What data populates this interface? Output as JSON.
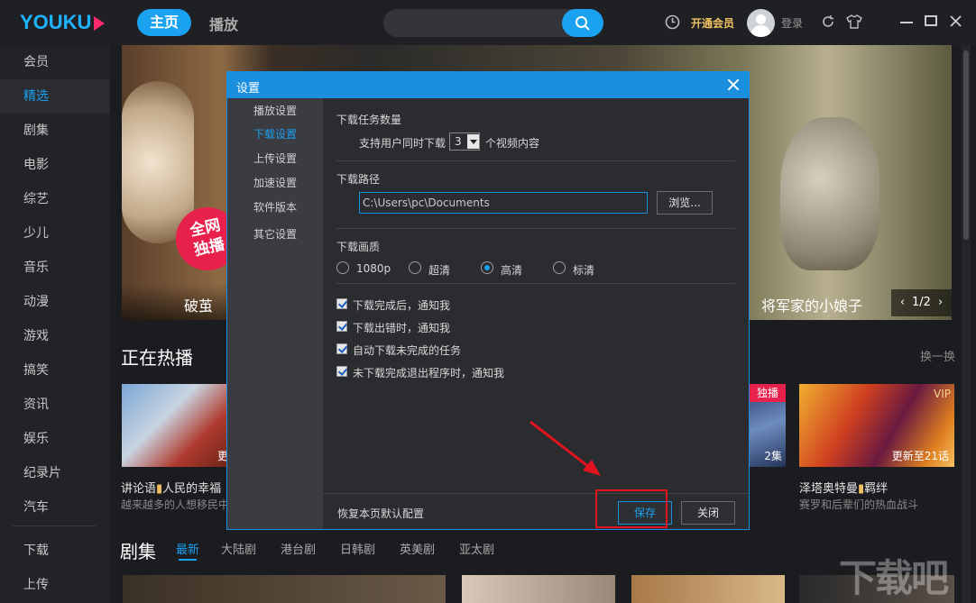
{
  "app": {
    "logo_main": "YOUKU",
    "nav_home": "主页",
    "nav_play": "播放",
    "search_placeholder": "",
    "vip_open": "开通会员",
    "login": "登录"
  },
  "sidebar": {
    "items": [
      {
        "label": "会员"
      },
      {
        "label": "精选"
      },
      {
        "label": "剧集"
      },
      {
        "label": "电影"
      },
      {
        "label": "综艺"
      },
      {
        "label": "少儿"
      },
      {
        "label": "音乐"
      },
      {
        "label": "动漫"
      },
      {
        "label": "游戏"
      },
      {
        "label": "搞笑"
      },
      {
        "label": "资讯"
      },
      {
        "label": "娱乐"
      },
      {
        "label": "纪录片"
      },
      {
        "label": "汽车"
      },
      {
        "label": "下载"
      },
      {
        "label": "上传"
      }
    ],
    "active_label": "精选"
  },
  "banner": {
    "badge": "全网\n独播",
    "left_title": "破茧",
    "right_title": "将军家的小娘子",
    "pager": "1/2",
    "prev": "‹",
    "next": "›"
  },
  "hot": {
    "title": "正在热播",
    "shuffle": "换一换",
    "cards": [
      {
        "title": "讲论语",
        "title_tail": "人民的幸福",
        "sub": "越来越多的人想移民中",
        "tag": "更"
      },
      {
        "title": "",
        "sub": "",
        "tag": "独播",
        "tag2": "2集"
      },
      {
        "title": "泽塔奥特曼",
        "title_tail": "羁绊",
        "sub": "赛罗和后辈们的热血战斗",
        "tag": "VIP",
        "tag2": "更新至21话"
      }
    ]
  },
  "series": {
    "title": "剧集",
    "tabs": [
      "最新",
      "大陆剧",
      "港台剧",
      "日韩剧",
      "英美剧",
      "亚太剧"
    ]
  },
  "dialog": {
    "title": "设置",
    "nav": [
      "播放设置",
      "下载设置",
      "上传设置",
      "加速设置",
      "软件版本",
      "其它设置"
    ],
    "active_nav": "下载设置",
    "task_count_label": "下载任务数量",
    "task_count_prefix": "支持用户同时下载",
    "task_count_value": "3",
    "task_count_suffix": "个视频内容",
    "path_label": "下载路径",
    "path_value": "C:\\Users\\pc\\Documents",
    "browse": "浏览...",
    "quality_label": "下载画质",
    "quality_options": [
      "1080p",
      "超清",
      "高清",
      "标清"
    ],
    "quality_selected": "高清",
    "checks": [
      {
        "label": "下载完成后，通知我",
        "checked": true
      },
      {
        "label": "下载出错时，通知我",
        "checked": true
      },
      {
        "label": "自动下载未完成的任务",
        "checked": true
      },
      {
        "label": "未下载完成退出程序时，通知我",
        "checked": true
      }
    ],
    "restore_default": "恢复本页默认配置",
    "save": "保存",
    "close": "关闭"
  },
  "watermark": "下载吧",
  "colors": {
    "accent": "#1aa1f0",
    "background": "#1b1c20",
    "dialog_bg": "#2b2c30",
    "annotation_red": "#e0141e"
  },
  "icons": [
    "search-icon",
    "clock-icon",
    "avatar-icon",
    "refresh-icon",
    "skin-icon",
    "minimize-icon",
    "maximize-icon",
    "close-icon"
  ]
}
